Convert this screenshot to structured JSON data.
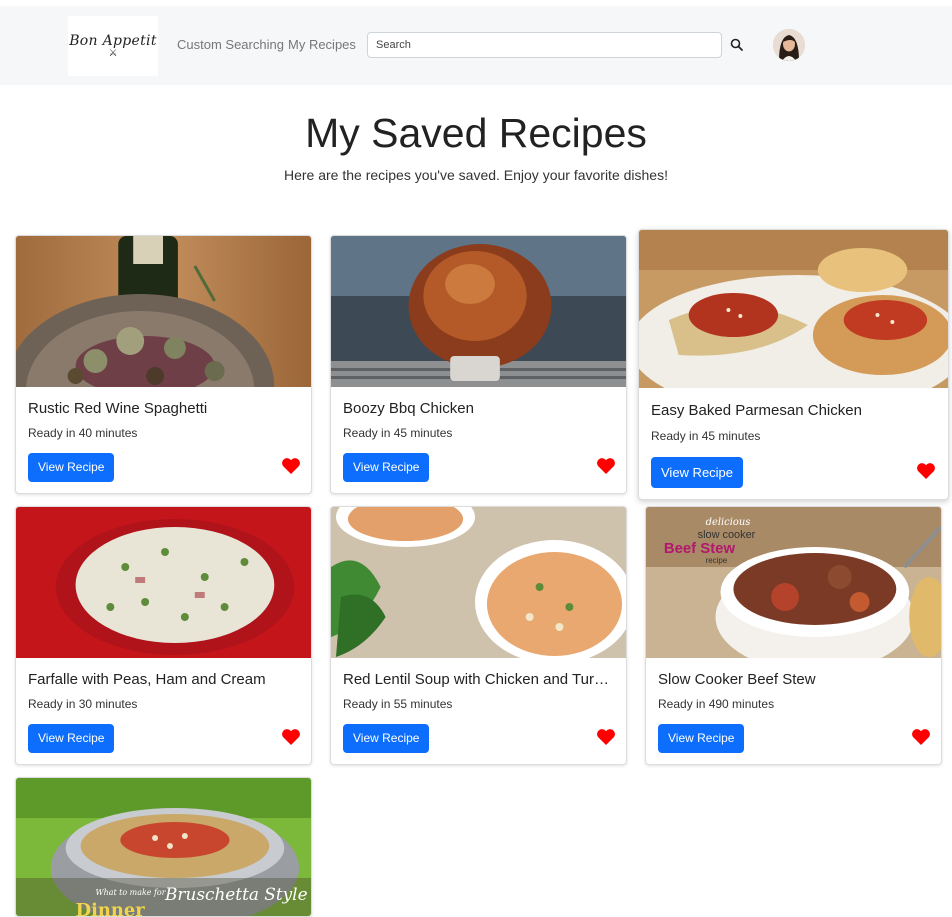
{
  "nav": {
    "logo_text": "Bon Appetit",
    "links": [
      "Custom Searching",
      "My Recipes"
    ],
    "search_placeholder": "Search",
    "search_icon": "search-icon",
    "avatar": "user-avatar"
  },
  "header": {
    "title": "My Saved Recipes",
    "subtitle": "Here are the recipes you've saved. Enjoy your favorite dishes!"
  },
  "colors": {
    "primary_button": "#0d6efd",
    "heart": "#ff0000",
    "navbar_bg": "#f6f7f8"
  },
  "recipes": [
    {
      "title": "Rustic Red Wine Spaghetti",
      "time": "Ready in 40 minutes",
      "button": "View Recipe",
      "icon": "heart-icon"
    },
    {
      "title": "Boozy Bbq Chicken",
      "time": "Ready in 45 minutes",
      "button": "View Recipe",
      "icon": "heart-icon"
    },
    {
      "title": "Easy Baked Parmesan Chicken",
      "time": "Ready in 45 minutes",
      "button": "View Recipe",
      "icon": "heart-icon"
    },
    {
      "title": "Farfalle with Peas, Ham and Cream",
      "time": "Ready in 30 minutes",
      "button": "View Recipe",
      "icon": "heart-icon"
    },
    {
      "title": "Red Lentil Soup with Chicken and Turnips",
      "time": "Ready in 55 minutes",
      "button": "View Recipe",
      "icon": "heart-icon"
    },
    {
      "title": "Slow Cooker Beef Stew",
      "time": "Ready in 490 minutes",
      "button": "View Recipe",
      "icon": "heart-icon"
    },
    {
      "title": "",
      "time": "",
      "button": "",
      "icon": "heart-icon"
    }
  ],
  "image_text": {
    "stew_banner": [
      "delicious",
      "slow cooker",
      "Beef Stew",
      "recipe"
    ],
    "salad_banner": [
      "What to make for",
      "Bruschetta Style",
      "Dinner"
    ]
  }
}
